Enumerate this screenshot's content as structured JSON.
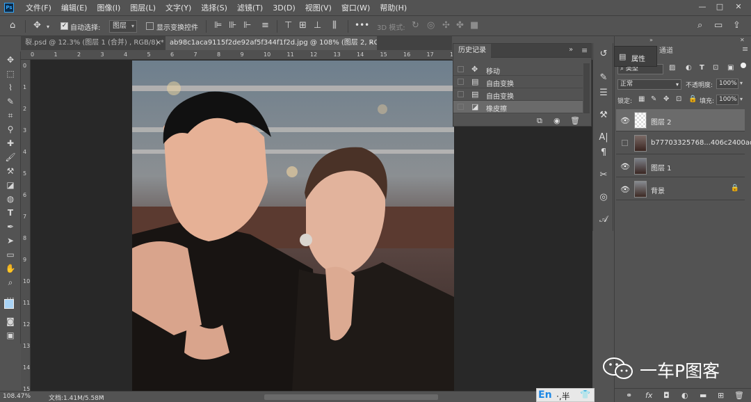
{
  "menubar": {
    "logo": "Ps",
    "items": [
      "文件(F)",
      "编辑(E)",
      "图像(I)",
      "图层(L)",
      "文字(Y)",
      "选择(S)",
      "滤镜(T)",
      "3D(D)",
      "视图(V)",
      "窗口(W)",
      "帮助(H)"
    ],
    "window_controls": [
      "—",
      "□",
      "✕"
    ]
  },
  "options": {
    "auto_select_label": "自动选择:",
    "auto_select_value": "图层",
    "show_transform_label": "显示变换控件",
    "mode_3d_label": "3D 模式:",
    "more": "•••"
  },
  "tabs": [
    {
      "label": "裂.psd @ 12.3% (图层 1 (合并) , RGB/8) *",
      "close": "×"
    },
    {
      "label": "ab98c1aca9115f2de92af5f344f1f2d.jpg @ 108% (图层 2, RGB/8) *",
      "close": "×"
    }
  ],
  "ruler": {
    "h_ticks": [
      "0",
      "1",
      "2",
      "3",
      "4",
      "5",
      "6",
      "7",
      "8",
      "9",
      "10",
      "11",
      "12",
      "13",
      "14",
      "15",
      "16",
      "17",
      "18"
    ],
    "v_ticks": [
      "0",
      "1",
      "2",
      "3",
      "4",
      "5",
      "6",
      "7",
      "8",
      "9",
      "10",
      "11",
      "12",
      "13",
      "14",
      "15"
    ]
  },
  "history": {
    "title": "历史记录",
    "menu_icon": "≡",
    "collapse": "»",
    "items": [
      {
        "icon": "move-icon",
        "label": "移动"
      },
      {
        "icon": "layer-icon",
        "label": "自由变换"
      },
      {
        "icon": "layer-icon",
        "label": "自由变换"
      },
      {
        "icon": "eraser-icon",
        "label": "橡皮擦"
      }
    ]
  },
  "properties": {
    "title": "属性"
  },
  "layers_panel": {
    "channels_tab": "通道",
    "kind_filter": "类型",
    "blend_mode": "正常",
    "opacity_label": "不透明度:",
    "opacity_value": "100%",
    "lock_label": "锁定:",
    "fill_label": "填充:",
    "fill_value": "100%",
    "layers": [
      {
        "name": "图层 2",
        "visible": true,
        "selected": true,
        "locked": false
      },
      {
        "name": "b77703325768...406c2400ad7",
        "visible": false,
        "selected": false,
        "locked": false
      },
      {
        "name": "图层 1",
        "visible": true,
        "selected": false,
        "locked": false
      },
      {
        "name": "背景",
        "visible": true,
        "selected": false,
        "locked": true
      }
    ]
  },
  "status": {
    "zoom": "108.47%",
    "doc_info": "文档:1.41M/5.58M"
  },
  "watermark": {
    "text": "一车P图客"
  },
  "ime": {
    "lang": "En",
    "marks": "·,半",
    "shirt": "👕"
  }
}
